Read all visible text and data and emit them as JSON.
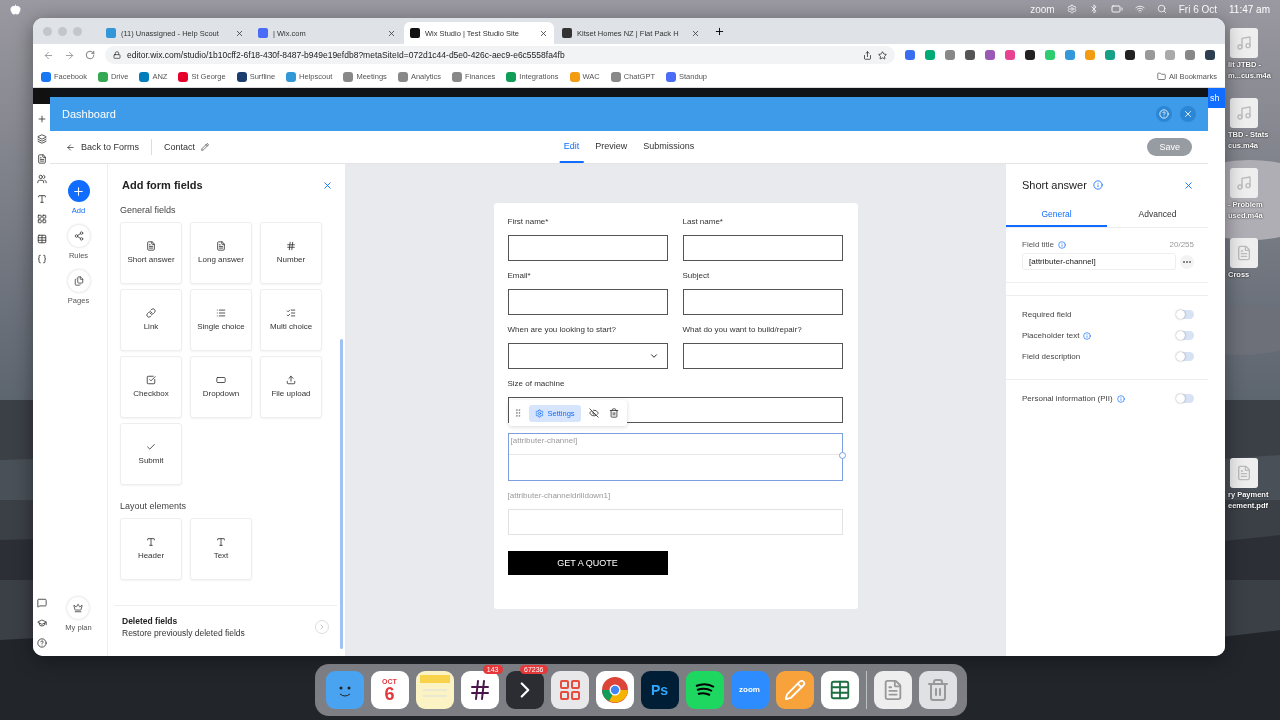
{
  "menu_bar": {
    "app": "zoom",
    "date": "Fri 6 Oct",
    "time": "11:47 am"
  },
  "browser": {
    "tabs": [
      {
        "title": "(11) Unassigned - Help Scout",
        "selected": false
      },
      {
        "title": "| Wix.com",
        "selected": false
      },
      {
        "title": "Wix Studio | Test Studio Site",
        "selected": true
      },
      {
        "title": "Kitset Homes NZ | Flat Pack H",
        "selected": false
      }
    ],
    "url": "editor.wix.com/studio/1b10cff2-6f18-430f-8487-b949e19efdb8?metaSiteId=072d1c44-d5e0-426c-aec9-e6c5558fa4fb",
    "bookmarks": [
      "Facebook",
      "Drive",
      "ANZ",
      "St George",
      "Surfline",
      "Helpscout",
      "Meetings",
      "Analytics",
      "Finances",
      "Integrations",
      "WAC",
      "ChatGPT",
      "Standup"
    ],
    "all_bookmarks": "All Bookmarks"
  },
  "editor": {
    "publish": "sh"
  },
  "dashboard": {
    "title": "Dashboard",
    "back": "Back to Forms",
    "form_name": "Contact",
    "tabs": [
      {
        "label": "Edit",
        "selected": true
      },
      {
        "label": "Preview",
        "selected": false
      },
      {
        "label": "Submissions",
        "selected": false
      }
    ],
    "save": {
      "label": "Save",
      "disabled": true
    }
  },
  "rail": [
    {
      "label": "Add",
      "kind": "add",
      "selected": true
    },
    {
      "label": "Rules",
      "kind": "rules",
      "selected": false
    },
    {
      "label": "Pages",
      "kind": "pages",
      "selected": false
    }
  ],
  "my_plan": "My plan",
  "add_panel": {
    "title": "Add form fields",
    "sections": [
      {
        "title": "General fields",
        "items": [
          {
            "label": "Short answer",
            "kind": "short"
          },
          {
            "label": "Long answer",
            "kind": "long"
          },
          {
            "label": "Number",
            "kind": "number"
          },
          {
            "label": "Link",
            "kind": "link"
          },
          {
            "label": "Single choice",
            "kind": "single"
          },
          {
            "label": "Multi choice",
            "kind": "multi"
          },
          {
            "label": "Checkbox",
            "kind": "checkbox"
          },
          {
            "label": "Dropdown",
            "kind": "dropdown"
          },
          {
            "label": "File upload",
            "kind": "upload"
          },
          {
            "label": "Submit",
            "kind": "submit"
          }
        ]
      },
      {
        "title": "Layout elements",
        "items": [
          {
            "label": "Header",
            "kind": "header"
          },
          {
            "label": "Text",
            "kind": "text"
          }
        ]
      }
    ],
    "deleted": {
      "title": "Deleted fields",
      "subtitle": "Restore previously deleted fields"
    }
  },
  "form": {
    "fields": [
      {
        "label": "First name*",
        "kind": "text",
        "full_width": false,
        "selected": false,
        "hidden": false
      },
      {
        "label": "Last name*",
        "kind": "text",
        "full_width": false,
        "selected": false,
        "hidden": false
      },
      {
        "label": "Email*",
        "kind": "text",
        "full_width": false,
        "selected": false,
        "hidden": false
      },
      {
        "label": "Subject",
        "kind": "text",
        "full_width": false,
        "selected": false,
        "hidden": false
      },
      {
        "label": "When are you looking to start?",
        "kind": "dropdown",
        "full_width": false,
        "selected": false,
        "hidden": false
      },
      {
        "label": "What do you want to build/repair?",
        "kind": "text",
        "full_width": false,
        "selected": false,
        "hidden": false
      },
      {
        "label": "Size of machine",
        "kind": "text",
        "full_width": true,
        "selected": false,
        "hidden": false
      },
      {
        "label": "[attributer-channel]",
        "kind": "text",
        "full_width": true,
        "selected": true,
        "hidden": true
      },
      {
        "label": "[attributer-channeldrilldown1]",
        "kind": "text",
        "full_width": true,
        "selected": false,
        "hidden": true
      }
    ],
    "toolbar": {
      "settings": "Settings"
    },
    "submit": "GET A QUOTE"
  },
  "settings_panel": {
    "title": "Short answer",
    "tabs": [
      {
        "label": "General",
        "selected": true
      },
      {
        "label": "Advanced",
        "selected": false
      }
    ],
    "field_title": {
      "label": "Field title",
      "count": "20/255",
      "value": "[attributer-channel]"
    },
    "toggles": [
      {
        "label": "Required field",
        "info": false,
        "on": false
      },
      {
        "label": "Placeholder text",
        "info": true,
        "on": false
      },
      {
        "label": "Field description",
        "info": false,
        "on": false
      },
      {
        "label": "Personal information (PII)",
        "info": true,
        "on": false
      }
    ]
  },
  "desktop_icons": [
    {
      "kind": "audio",
      "lines": [
        "lit JTBD -",
        "m...cus.m4a"
      ]
    },
    {
      "kind": "audio",
      "lines": [
        "TBD - Stats",
        "cus.m4a"
      ]
    },
    {
      "kind": "audio",
      "lines": [
        "- Problem",
        "used.m4a"
      ]
    },
    {
      "kind": "doc",
      "lines": [
        "Cross"
      ]
    },
    {
      "kind": "pdf",
      "lines": [
        "ry Payment",
        "eement.pdf"
      ]
    }
  ],
  "dock": [
    {
      "kind": "finder"
    },
    {
      "kind": "calendar",
      "texts": [
        "OCT",
        "6"
      ]
    },
    {
      "kind": "notes"
    },
    {
      "kind": "slack",
      "badge": "143"
    },
    {
      "kind": "arrow",
      "badge": "67236"
    },
    {
      "kind": "launchpad"
    },
    {
      "kind": "chrome"
    },
    {
      "kind": "ps",
      "texts": [
        "Ps"
      ]
    },
    {
      "kind": "spotify"
    },
    {
      "kind": "zoom",
      "texts": [
        "zoom"
      ]
    },
    {
      "kind": "pages"
    },
    {
      "kind": "excel"
    },
    {
      "kind": "divider"
    },
    {
      "kind": "csv"
    },
    {
      "kind": "trash"
    }
  ]
}
